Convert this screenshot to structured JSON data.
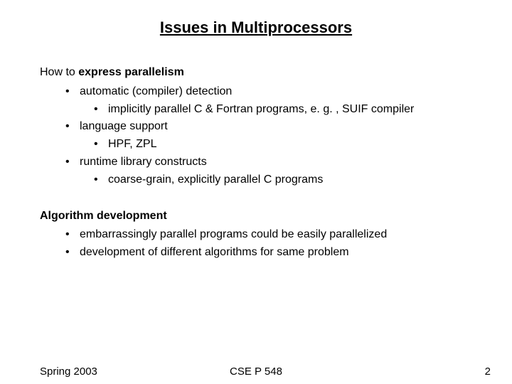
{
  "title": "Issues in Multiprocessors",
  "section1": {
    "intro_plain": "How to ",
    "intro_bold": "express parallelism",
    "items": [
      {
        "text": "automatic (compiler) detection",
        "sub": [
          "implicitly parallel C & Fortran programs, e. g. , SUIF compiler"
        ]
      },
      {
        "text": "language support",
        "sub": [
          "HPF, ZPL"
        ]
      },
      {
        "text": "runtime library constructs",
        "sub": [
          "coarse-grain, explicitly parallel C programs"
        ]
      }
    ]
  },
  "section2": {
    "heading": "Algorithm development",
    "items": [
      "embarrassingly parallel programs could be easily parallelized",
      "development of different algorithms for same problem"
    ]
  },
  "footer": {
    "left": "Spring 2003",
    "center": "CSE P 548",
    "right": "2"
  }
}
